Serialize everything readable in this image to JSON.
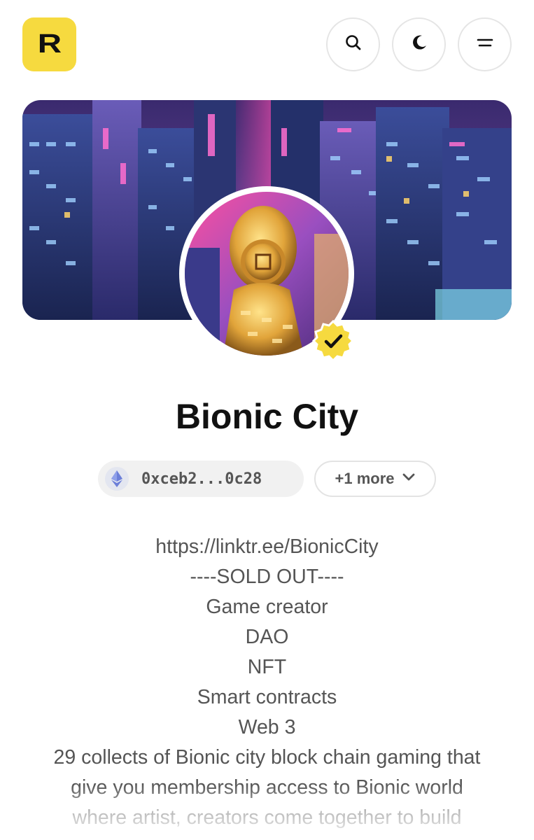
{
  "header": {
    "logo_letter": "R",
    "search_icon": "search-icon",
    "theme_icon": "moon-icon",
    "menu_icon": "menu-icon"
  },
  "profile": {
    "name": "Bionic City",
    "verified_icon": "verified-badge-icon",
    "wallet": {
      "chain_icon": "ethereum-icon",
      "address": "0xceb2...0c28"
    },
    "more_wallets_label": "+1 more",
    "bio_lines": [
      "https://linktr.ee/BionicCity",
      "----SOLD OUT----",
      "Game creator",
      "DAO",
      "NFT",
      "Smart contracts",
      "Web 3",
      "29 collects of Bionic city block chain gaming that",
      "give you membership access to Bionic world",
      "where artist, creators come together to build"
    ]
  },
  "colors": {
    "brand_yellow": "#f6da3f",
    "text_primary": "#111111",
    "text_secondary": "#555555"
  }
}
